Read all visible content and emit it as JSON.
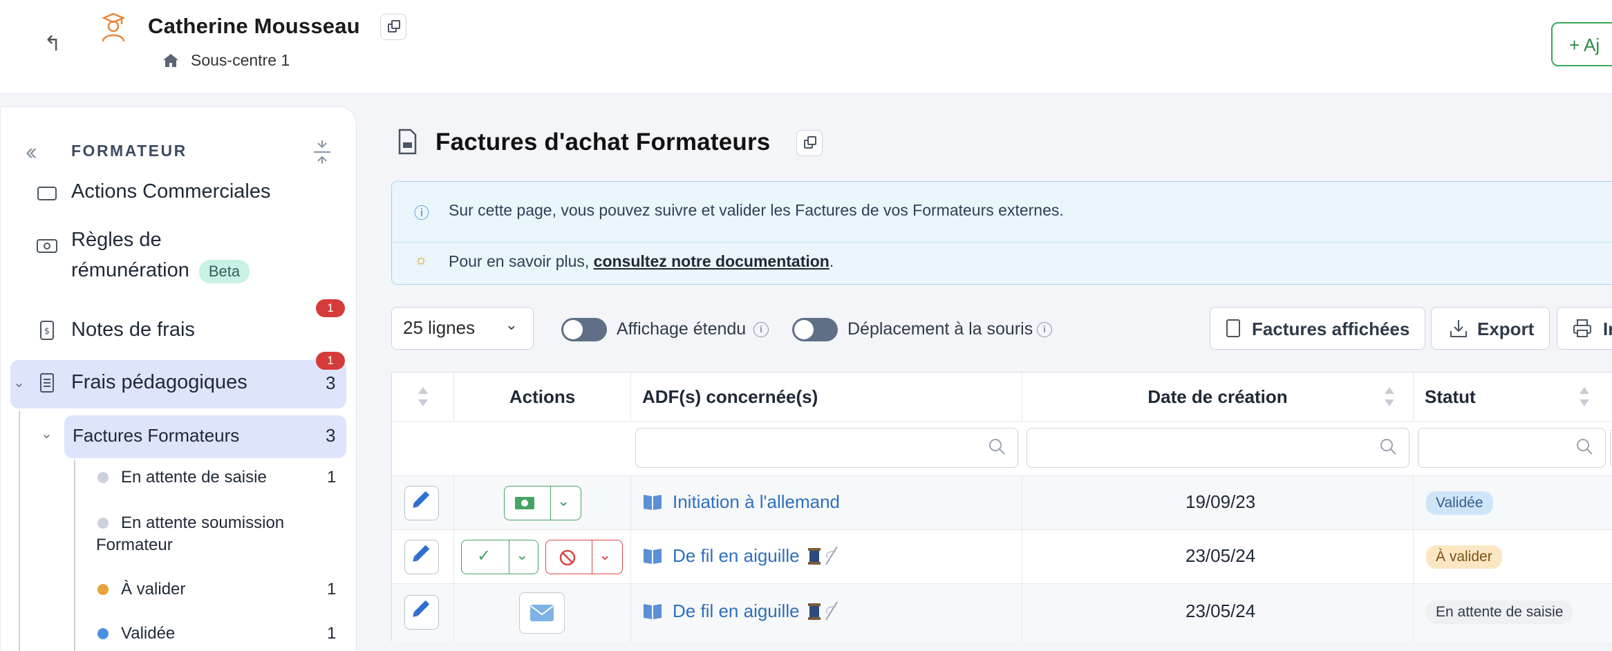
{
  "header": {
    "user_name": "Catherine Mousseau",
    "sub_centre": "Sous-centre 1",
    "add_button_label": "+ Aj"
  },
  "sidebar": {
    "title": "FORMATEUR",
    "items": [
      {
        "label": "Actions Commerciales"
      },
      {
        "label_line1": "Règles de",
        "label_line2": "rémunération",
        "badge": "Beta"
      },
      {
        "label": "Notes de frais",
        "notif": "1"
      },
      {
        "label": "Frais pédagogiques",
        "count": "3",
        "notif": "1"
      },
      {
        "label": "Factures Formateurs",
        "count": "3"
      }
    ],
    "subitems": [
      {
        "label": "En attente de saisie",
        "count": "1",
        "color": "#cbd1da"
      },
      {
        "label_line1": "En attente soumission",
        "label_line2": "Formateur",
        "color": "#cbd1da"
      },
      {
        "label": "À valider",
        "count": "1",
        "color": "#e8a23d"
      },
      {
        "label": "Validée",
        "count": "1",
        "color": "#4a90e2"
      }
    ]
  },
  "main": {
    "title": "Factures d'achat Formateurs",
    "info_line1": "Sur cette page, vous pouvez suivre et valider les Factures de vos Formateurs externes.",
    "info_line2_prefix": "Pour en savoir plus, ",
    "info_line2_link": "consultez notre documentation",
    "info_line2_suffix": ".",
    "rows_select": "25 lignes",
    "toggle1_label": "Affichage étendu",
    "toggle2_label": "Déplacement à la souris",
    "btn_factures": "Factures affichées",
    "btn_export": "Export",
    "btn_print": "In"
  },
  "table": {
    "headers": [
      "Actions",
      "ADF(s) concernée(s)",
      "Date de création",
      "Statut"
    ],
    "rows": [
      {
        "adf": "Initiation à l'allemand",
        "date": "19/09/23",
        "status": "Validée",
        "status_bg": "#cfe4f7",
        "status_fg": "#2f5f8f"
      },
      {
        "adf": "De fil en aiguille",
        "date": "23/05/24",
        "status": "À valider",
        "status_bg": "#fbe7c4",
        "status_fg": "#7a5316"
      },
      {
        "adf": "De fil en aiguille",
        "date": "23/05/24",
        "status": "En attente de saisie",
        "status_bg": "#eef0f3",
        "status_fg": "#2f3a4a"
      }
    ]
  }
}
